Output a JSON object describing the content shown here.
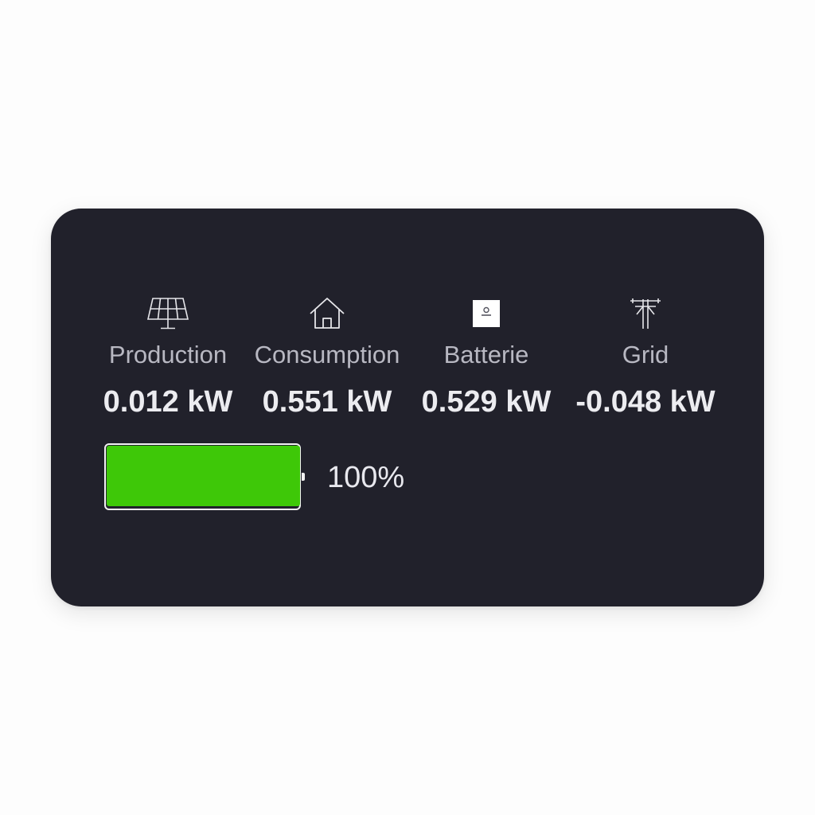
{
  "metrics": [
    {
      "icon": "solar-panel-icon",
      "label": "Production",
      "value": "0.012 kW"
    },
    {
      "icon": "house-icon",
      "label": "Consumption",
      "value": "0.551 kW"
    },
    {
      "icon": "battery-unit-icon",
      "label": "Batterie",
      "value": "0.529 kW"
    },
    {
      "icon": "power-pole-icon",
      "label": "Grid",
      "value": "-0.048 kW"
    }
  ],
  "battery": {
    "level_percent": 100,
    "percent_text": "100%",
    "fill_color": "#3ec808"
  },
  "colors": {
    "card_background": "#21212b",
    "label_text": "#b8b8c2",
    "value_text": "#ececf0"
  }
}
